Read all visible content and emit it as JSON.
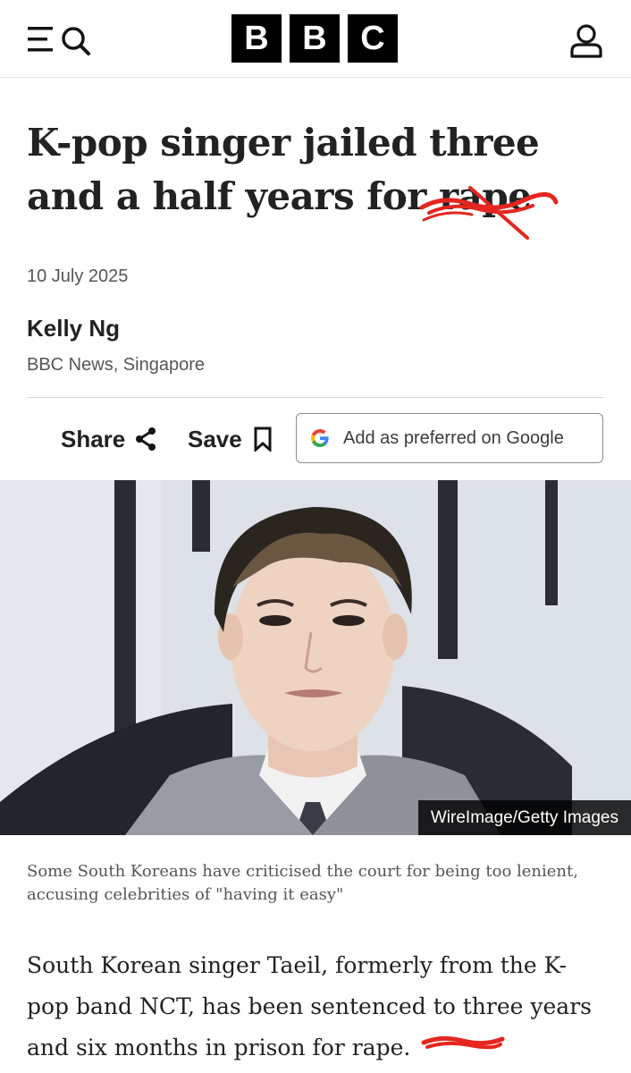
{
  "header": {
    "logo_letters": [
      "B",
      "B",
      "C"
    ],
    "icons": {
      "menu": "menu-icon",
      "search": "search-icon",
      "account": "account-icon"
    }
  },
  "article": {
    "headline_visible": "K-pop singer jailed three and a half years for",
    "headline_obscured_word": "rape",
    "date": "10 July 2025",
    "author": "Kelly Ng",
    "outlet": "BBC News, Singapore",
    "actions": {
      "share_label": "Share",
      "save_label": "Save",
      "google_label": "Add as preferred on Google"
    },
    "image": {
      "credit": "WireImage/Getty Images",
      "caption": "Some South Koreans have criticised the court for being too lenient, accusing celebrities of \"having it easy\""
    },
    "body_visible": "South Korean singer Taeil, formerly from the K-pop band NCT, has been sentenced to three years and six months in prison for",
    "body_obscured_word": "rape."
  },
  "colors": {
    "brand_black": "#000000",
    "scribble_red": "#e5261f",
    "text_dark": "#202224",
    "text_muted": "#545658"
  }
}
